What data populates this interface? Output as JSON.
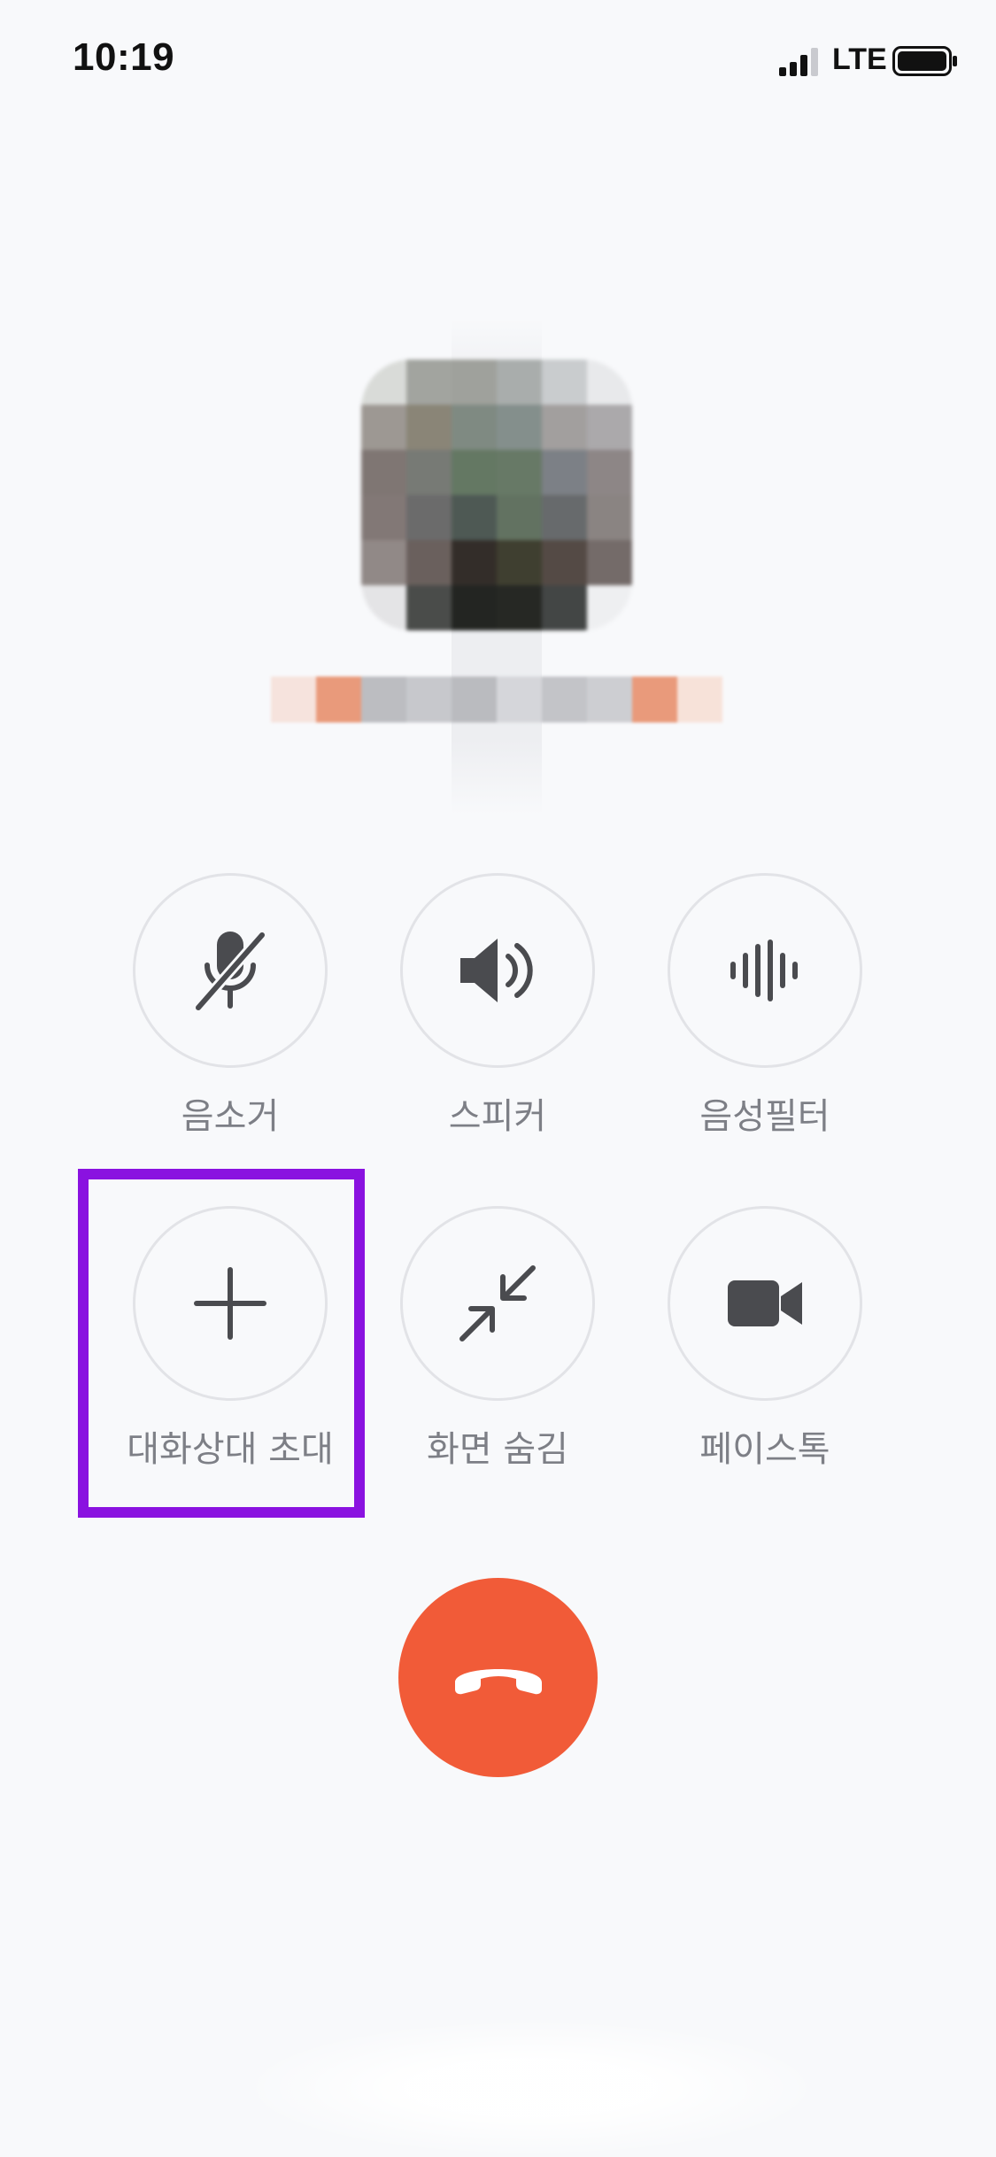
{
  "status_bar": {
    "time": "10:19",
    "network": "LTE",
    "signal_icon": "cellular-signal-icon",
    "battery_icon": "battery-full-icon"
  },
  "profile": {
    "avatar_icon": "pixelated-profile-photo",
    "name_obscured": true
  },
  "controls": [
    {
      "id": "mute",
      "label": "음소거",
      "icon": "mic-off-icon"
    },
    {
      "id": "speaker",
      "label": "스피커",
      "icon": "speaker-icon"
    },
    {
      "id": "voice_filter",
      "label": "음성필터",
      "icon": "audio-wave-icon"
    },
    {
      "id": "invite",
      "label": "대화상대 초대",
      "icon": "plus-icon"
    },
    {
      "id": "hide_screen",
      "label": "화면 숨김",
      "icon": "minimize-arrows-icon"
    },
    {
      "id": "facetalk",
      "label": "페이스톡",
      "icon": "video-camera-icon"
    }
  ],
  "end_call": {
    "icon": "hang-up-phone-icon",
    "color": "#f15b38"
  },
  "highlight": {
    "target": "invite",
    "color": "#8a12e0"
  }
}
